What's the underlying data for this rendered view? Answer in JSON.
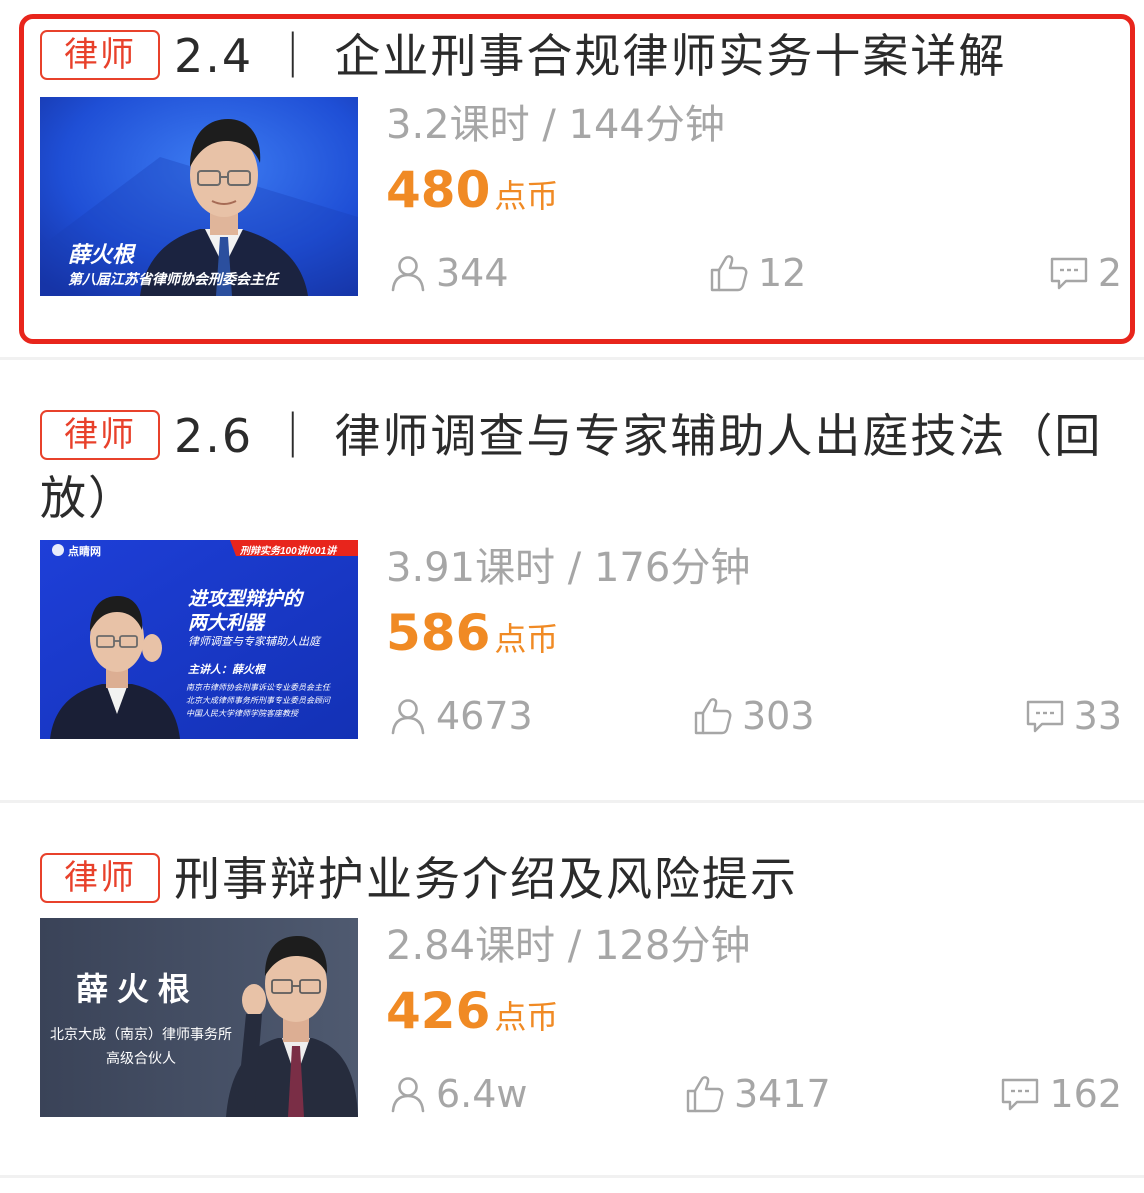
{
  "courses": [
    {
      "tag": "律师",
      "title": "2.4 ｜ 企业刑事合规律师实务十案详解",
      "duration": "3.2课时 / 144分钟",
      "price": "480",
      "price_unit": "点币",
      "views": "344",
      "likes": "12",
      "comments": "2",
      "thumbnail": {
        "name": "薛火根",
        "subtitle": "第八届江苏省律师协会刑委会主任"
      }
    },
    {
      "tag": "律师",
      "title": "2.6 ｜ 律师调查与专家辅助人出庭技法（回放）",
      "duration": "3.91课时 / 176分钟",
      "price": "586",
      "price_unit": "点币",
      "views": "4673",
      "likes": "303",
      "comments": "33",
      "thumbnail": {
        "brand": "点睛网",
        "badge": "刑辩实务100讲/001讲",
        "headline_1": "进攻型辩护的",
        "headline_2": "两大利器",
        "subline": "律师调查与专家辅助人出庭",
        "speaker": "主讲人：薛火根",
        "bio_1": "南京市律师协会刑事诉讼专业委员会主任",
        "bio_2": "北京大成律师事务所刑事专业委员会顾问",
        "bio_3": "中国人民大学律师学院客座教授"
      }
    },
    {
      "tag": "律师",
      "title": "刑事辩护业务介绍及风险提示",
      "duration": "2.84课时 / 128分钟",
      "price": "426",
      "price_unit": "点币",
      "views": "6.4w",
      "likes": "3417",
      "comments": "162",
      "thumbnail": {
        "name": "薛 火 根",
        "firm": "北京大成（南京）律师事务所",
        "role": "高级合伙人"
      }
    }
  ],
  "colors": {
    "tag": "#e8412b",
    "highlight": "#e8251c",
    "price": "#f08a24",
    "meta": "#a6a6a6",
    "title": "#2b2b2b"
  },
  "icons": {
    "views": "user-icon",
    "likes": "thumbs-up-icon",
    "comments": "comment-icon"
  }
}
